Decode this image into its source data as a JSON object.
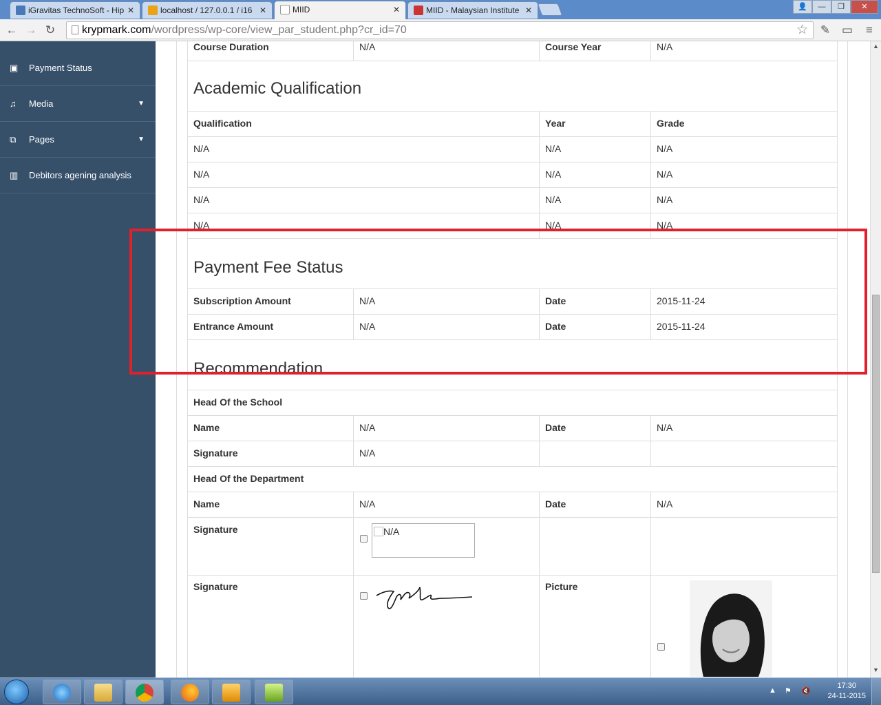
{
  "browser": {
    "tabs": [
      {
        "title": "iGravitas TechnoSoft - Hip",
        "favicon_color": "#4a78b8"
      },
      {
        "title": "localhost / 127.0.0.1 / i16",
        "favicon_color": "#e8a317"
      },
      {
        "title": "MIID",
        "favicon_color": "#ffffff"
      },
      {
        "title": "MIID - Malaysian Institute",
        "favicon_color": "#cc3333"
      }
    ],
    "url_host": "krypmark.com",
    "url_path": "/wordpress/wp-core/view_par_student.php?cr_id=70"
  },
  "sidebar": {
    "items": [
      {
        "label": "Payment Status",
        "icon": "money-icon",
        "has_caret": false
      },
      {
        "label": "Media",
        "icon": "music-icon",
        "has_caret": true
      },
      {
        "label": "Pages",
        "icon": "pages-icon",
        "has_caret": true
      },
      {
        "label": "Debitors agening analysis",
        "icon": "chart-icon",
        "has_caret": false
      }
    ]
  },
  "course": {
    "duration_label": "Course Duration",
    "duration_value": "N/A",
    "year_label": "Course Year",
    "year_value": "N/A"
  },
  "academic": {
    "title": "Academic Qualification",
    "headers": [
      "Qualification",
      "Year",
      "Grade"
    ],
    "rows": [
      [
        "N/A",
        "N/A",
        "N/A"
      ],
      [
        "N/A",
        "N/A",
        "N/A"
      ],
      [
        "N/A",
        "N/A",
        "N/A"
      ],
      [
        "N/A",
        "N/A",
        "N/A"
      ]
    ]
  },
  "payment": {
    "title": "Payment Fee Status",
    "rows": [
      {
        "label": "Subscription Amount",
        "value": "N/A",
        "date_label": "Date",
        "date_value": "2015-11-24"
      },
      {
        "label": "Entrance Amount",
        "value": "N/A",
        "date_label": "Date",
        "date_value": "2015-11-24"
      }
    ]
  },
  "recommendation": {
    "title": "Recommendation",
    "school_heading": "Head Of the School",
    "school_name_label": "Name",
    "school_name_value": "N/A",
    "school_date_label": "Date",
    "school_date_value": "N/A",
    "school_sig_label": "Signature",
    "school_sig_value": "N/A",
    "dept_heading": "Head Of the Department",
    "dept_name_label": "Name",
    "dept_name_value": "N/A",
    "dept_date_label": "Date",
    "dept_date_value": "N/A",
    "dept_sig_label": "Signature",
    "dept_sig_alt": "N/A"
  },
  "student": {
    "signature_label": "Signature",
    "picture_label": "Picture"
  },
  "taskbar": {
    "time": "17:30",
    "date": "24-11-2015"
  },
  "colors": {
    "sidebar_bg": "#36506a",
    "highlight": "#e0202a"
  }
}
